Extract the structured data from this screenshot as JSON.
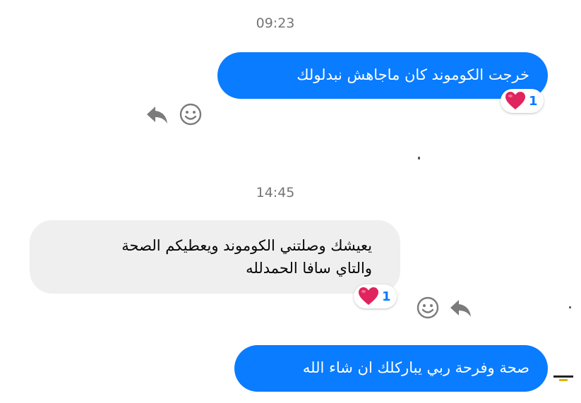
{
  "messages": [
    {
      "type": "timestamp",
      "text": "09:23"
    },
    {
      "type": "outgoing",
      "text": "خرجت الكوموند كان ماجاهش نبدلولك",
      "reaction": {
        "emoji": "heart-icon",
        "count": "1"
      }
    },
    {
      "type": "timestamp",
      "text": "14:45"
    },
    {
      "type": "incoming",
      "lines": [
        "يعيشك وصلتني الكوموند ويعطيكم الصحة",
        "والتاي سافا  الحمدلله"
      ],
      "reaction": {
        "emoji": "heart-icon",
        "count": "1"
      }
    },
    {
      "type": "outgoing",
      "text": "صحة وفرحة ربي يباركلك ان شاء الله"
    }
  ],
  "colors": {
    "outgoing_bubble": "#0a7cff",
    "incoming_bubble": "#efefef",
    "timestamp": "#757575",
    "heart": "#e0245e"
  }
}
